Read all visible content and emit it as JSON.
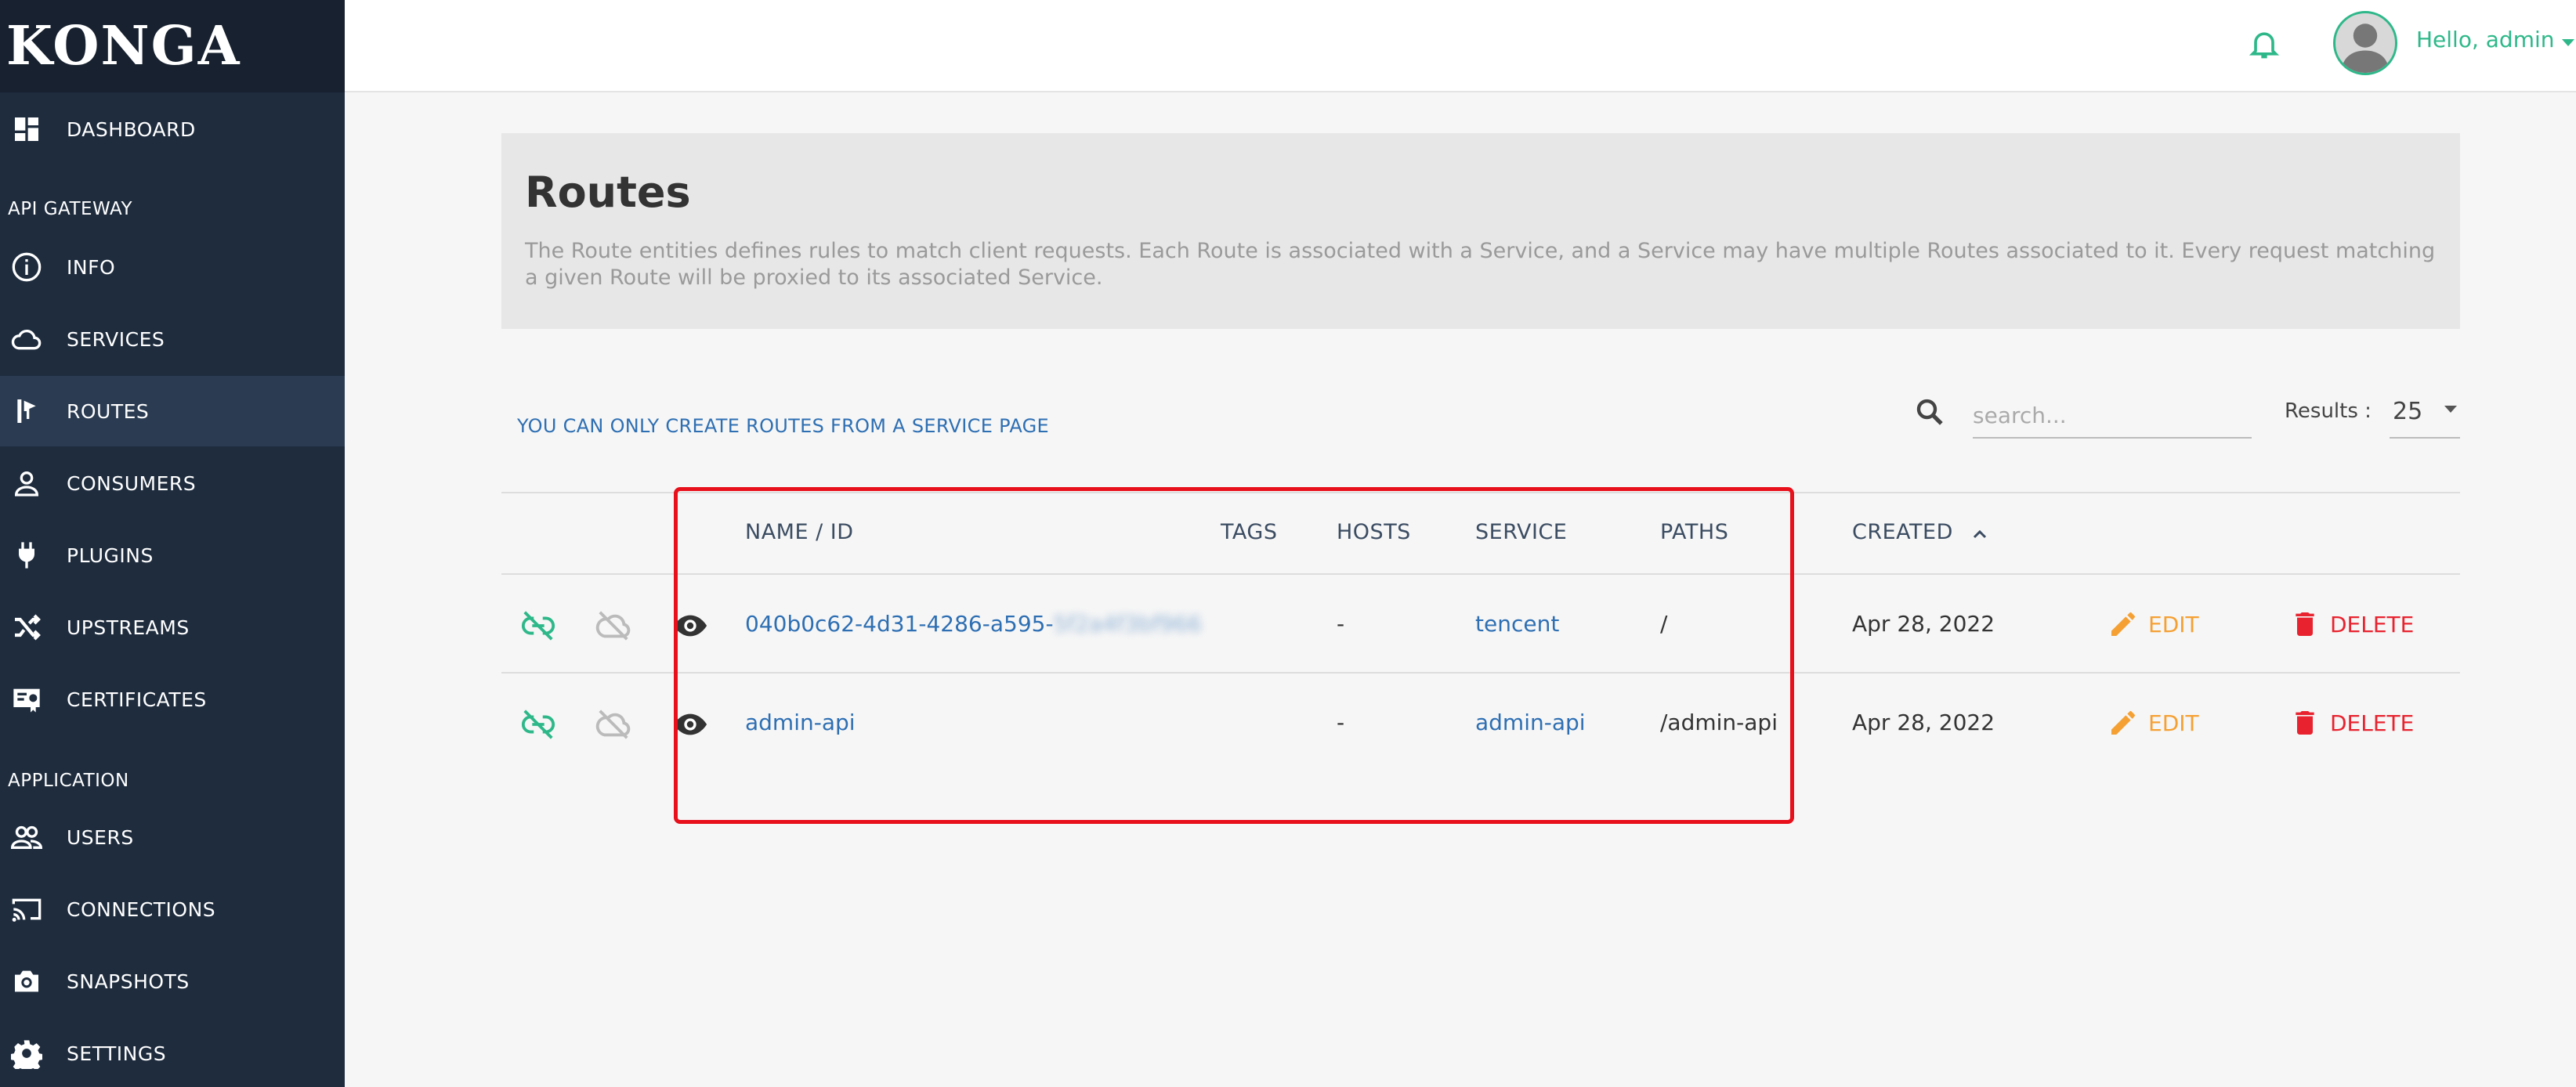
{
  "app": {
    "logo": "KONGA"
  },
  "sidebar": {
    "dashboard": "DASHBOARD",
    "section_gateway": "API GATEWAY",
    "info": "INFO",
    "services": "SERVICES",
    "routes": "ROUTES",
    "consumers": "CONSUMERS",
    "plugins": "PLUGINS",
    "upstreams": "UPSTREAMS",
    "certificates": "CERTIFICATES",
    "section_application": "APPLICATION",
    "users": "USERS",
    "connections": "CONNECTIONS",
    "snapshots": "SNAPSHOTS",
    "settings": "SETTINGS"
  },
  "topbar": {
    "greeting": "Hello, admin"
  },
  "header": {
    "title": "Routes",
    "description": "The Route entities defines rules to match client requests. Each Route is associated with a Service, and a Service may have multiple Routes associated to it. Every request matching a given Route will be proxied to its associated Service."
  },
  "toolbar": {
    "notice": "YOU CAN ONLY CREATE ROUTES FROM A SERVICE PAGE",
    "search_placeholder": "search...",
    "results_label": "Results :",
    "results_value": "25"
  },
  "table": {
    "columns": {
      "name": "NAME / ID",
      "tags": "TAGS",
      "hosts": "HOSTS",
      "service": "SERVICE",
      "paths": "PATHS",
      "created": "CREATED"
    },
    "rows": [
      {
        "name_prefix": "040b0c62-4d31-4286-a595-",
        "name_hidden": "5f2a4f3bf966",
        "hosts": "-",
        "service": "tencent",
        "paths": "/",
        "created": "Apr 28, 2022",
        "edit": "EDIT",
        "delete": "DELETE"
      },
      {
        "name_prefix": "admin-api",
        "name_hidden": "",
        "hosts": "-",
        "service": "admin-api",
        "paths": "/admin-api",
        "created": "Apr 28, 2022",
        "edit": "EDIT",
        "delete": "DELETE"
      }
    ]
  },
  "colors": {
    "sidebar": "#1e2c3e",
    "accent_green": "#2eb88a",
    "link_blue": "#2e6fb3",
    "edit_orange": "#f5a033",
    "delete_red": "#e8232f",
    "highlight_red": "#e8101b"
  }
}
